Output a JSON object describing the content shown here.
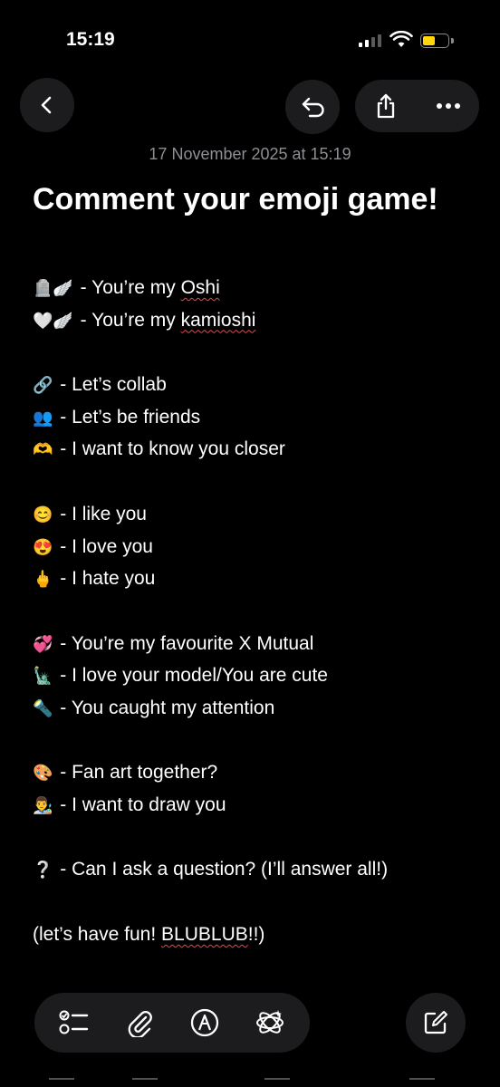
{
  "status_bar": {
    "time": "15:19",
    "battery_level": 0.55,
    "battery_color": "#ffd60a"
  },
  "nav": {
    "back_icon": "chevron-left-icon",
    "undo_icon": "undo-icon",
    "share_icon": "share-icon",
    "more_icon": "ellipsis-icon"
  },
  "note": {
    "date": "17 November 2025 at 15:19",
    "title": "Comment your emoji game!",
    "lines": [
      {
        "emoji": "🪦🪽",
        "text": " - You’re my ",
        "flagged": "Oshi",
        "after": ""
      },
      {
        "emoji": "🤍🪽",
        "text": " - You’re my ",
        "flagged": "kamioshi",
        "after": ""
      },
      {
        "emoji": "",
        "text": "",
        "flagged": "",
        "after": ""
      },
      {
        "emoji": "🔗",
        "text": " - Let’s collab",
        "flagged": "",
        "after": ""
      },
      {
        "emoji": "👥",
        "text": " - Let’s be friends",
        "flagged": "",
        "after": ""
      },
      {
        "emoji": "🫶",
        "text": " - I want to know you closer",
        "flagged": "",
        "after": ""
      },
      {
        "emoji": "",
        "text": "",
        "flagged": "",
        "after": ""
      },
      {
        "emoji": "😊",
        "text": " - I like you",
        "flagged": "",
        "after": ""
      },
      {
        "emoji": "😍",
        "text": " - I love you",
        "flagged": "",
        "after": ""
      },
      {
        "emoji": "🖕",
        "text": " - I hate you",
        "flagged": "",
        "after": ""
      },
      {
        "emoji": "",
        "text": "",
        "flagged": "",
        "after": ""
      },
      {
        "emoji": "💞",
        "text": " - You’re my favourite X Mutual",
        "flagged": "",
        "after": ""
      },
      {
        "emoji": "🗽",
        "text": " - I love your model/You are cute",
        "flagged": "",
        "after": ""
      },
      {
        "emoji": "🔦",
        "text": " - You caught my attention",
        "flagged": "",
        "after": ""
      },
      {
        "emoji": "",
        "text": "",
        "flagged": "",
        "after": ""
      },
      {
        "emoji": "🎨",
        "text": " - Fan art together?",
        "flagged": "",
        "after": ""
      },
      {
        "emoji": "👨‍🎨",
        "text": " - I want to draw you",
        "flagged": "",
        "after": ""
      },
      {
        "emoji": "",
        "text": "",
        "flagged": "",
        "after": ""
      },
      {
        "emoji": " ❔",
        "text": " - Can I ask a question? (I’ll answer all!)",
        "flagged": "",
        "after": ""
      },
      {
        "emoji": "",
        "text": "",
        "flagged": "",
        "after": ""
      },
      {
        "emoji": "",
        "text": "(let’s have fun! ",
        "flagged": "BLUBLUB",
        "after": "!!)"
      }
    ]
  },
  "toolbar": {
    "items": [
      {
        "icon": "checklist-icon"
      },
      {
        "icon": "paperclip-icon"
      },
      {
        "icon": "markup-pen-icon"
      },
      {
        "icon": "apple-intelligence-icon"
      }
    ],
    "compose_icon": "compose-icon"
  }
}
